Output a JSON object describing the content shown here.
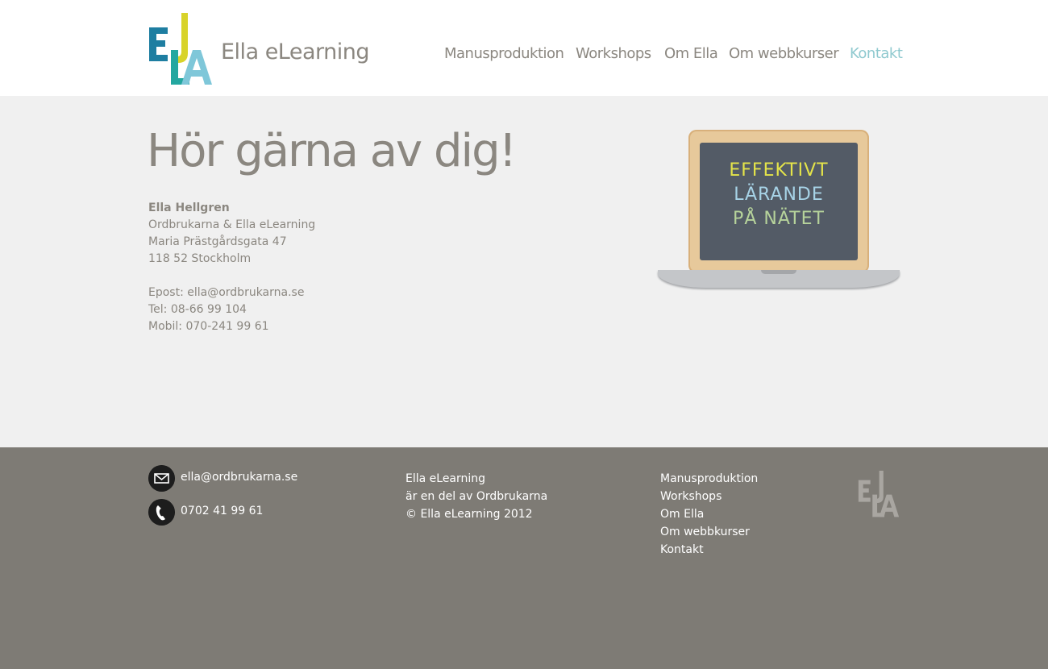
{
  "header": {
    "logo_text": "Ella eLearning",
    "nav": [
      {
        "label": "Manusproduktion",
        "active": false
      },
      {
        "label": "Workshops",
        "active": false
      },
      {
        "label": "Om Ella",
        "active": false
      },
      {
        "label": "Om webbkurser",
        "active": false
      },
      {
        "label": "Kontakt",
        "active": true
      }
    ]
  },
  "main": {
    "headline": "Hör gärna av dig!",
    "contact": {
      "name": "Ella Hellgren",
      "company": "Ordbrukarna & Ella eLearning",
      "street": "Maria Prästgårdsgata 47",
      "city": "118 52 Stockholm",
      "email": "Epost: ella@ordbrukarna.se",
      "phone": "Tel: 08-66 99 104",
      "mobile": "Mobil: 070-241 99 61"
    },
    "laptop_board": {
      "line1": "EFFEKTIVT",
      "line2": "LÄRANDE",
      "line3": "PÅ NÄTET"
    }
  },
  "footer": {
    "email": "ella@ordbrukarna.se",
    "phone": "0702 41 99 61",
    "about": [
      "Ella eLearning",
      "är en del av Ordbrukarna",
      "© Ella eLearning 2012"
    ],
    "nav": [
      "Manusproduktion",
      "Workshops",
      "Om Ella",
      "Om webbkurser",
      "Kontakt"
    ]
  },
  "colors": {
    "logo_blue": "#1e7ea1",
    "logo_yellow": "#d8d32a",
    "logo_teal": "#23a7a0",
    "logo_light_blue": "#7fc7d9",
    "nav_active": "#8fc9cf",
    "board_yellow": "#e4e44a",
    "board_blue": "#a7d3e7",
    "board_green": "#b6d39b",
    "footer_bg": "#7e7b75"
  },
  "icons": {
    "email": "envelope-icon",
    "phone": "phone-icon"
  }
}
